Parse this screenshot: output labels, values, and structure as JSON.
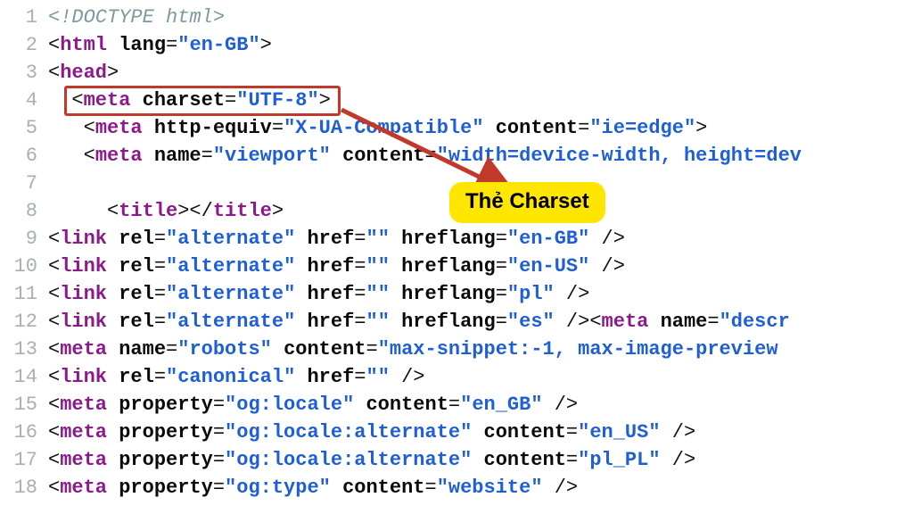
{
  "callout": "Thẻ Charset",
  "gutter": [
    "1",
    "2",
    "3",
    "4",
    "5",
    "6",
    "7",
    "8",
    "9",
    "10",
    "11",
    "12",
    "13",
    "14",
    "15",
    "16",
    "17",
    "18"
  ],
  "code": {
    "l1": "<!DOCTYPE html>",
    "l2_tag": "html",
    "l2_attr": "lang",
    "l2_val": "en-GB",
    "l3_tag": "head",
    "l4_tag": "meta",
    "l4_attr": "charset",
    "l4_val": "UTF-8",
    "l5_tag": "meta",
    "l5_a1": "http-equiv",
    "l5_v1": "X-UA-Compatible",
    "l5_a2": "content",
    "l5_v2": "ie=edge",
    "l6_tag": "meta",
    "l6_a1": "name",
    "l6_v1": "viewport",
    "l6_a2": "content",
    "l6_v2": "width=device-width, height=dev",
    "l8_tag": "title",
    "l9_tag": "link",
    "l9_a1": "rel",
    "l9_v1": "alternate",
    "l9_a2": "href",
    "l9_v2": "",
    "l9_a3": "hreflang",
    "l9_v3": "en-GB",
    "l10_tag": "link",
    "l10_a1": "rel",
    "l10_v1": "alternate",
    "l10_a2": "href",
    "l10_v2": "",
    "l10_a3": "hreflang",
    "l10_v3": "en-US",
    "l11_tag": "link",
    "l11_a1": "rel",
    "l11_v1": "alternate",
    "l11_a2": "href",
    "l11_v2": "",
    "l11_a3": "hreflang",
    "l11_v3": "pl",
    "l12_tag": "link",
    "l12_a1": "rel",
    "l12_v1": "alternate",
    "l12_a2": "href",
    "l12_v2": "",
    "l12_a3": "hreflang",
    "l12_v3": "es",
    "l12_tag2": "meta",
    "l12_a4": "name",
    "l12_v4": "descr",
    "l13_tag": "meta",
    "l13_a1": "name",
    "l13_v1": "robots",
    "l13_a2": "content",
    "l13_v2": "max-snippet:-1, max-image-preview",
    "l14_tag": "link",
    "l14_a1": "rel",
    "l14_v1": "canonical",
    "l14_a2": "href",
    "l14_v2": "",
    "l15_tag": "meta",
    "l15_a1": "property",
    "l15_v1": "og:locale",
    "l15_a2": "content",
    "l15_v2": "en_GB",
    "l16_tag": "meta",
    "l16_a1": "property",
    "l16_v1": "og:locale:alternate",
    "l16_a2": "content",
    "l16_v2": "en_US",
    "l17_tag": "meta",
    "l17_a1": "property",
    "l17_v1": "og:locale:alternate",
    "l17_a2": "content",
    "l17_v2": "pl_PL",
    "l18_tag": "meta",
    "l18_a1": "property",
    "l18_v1": "og:type",
    "l18_a2": "content",
    "l18_v2": "website"
  }
}
